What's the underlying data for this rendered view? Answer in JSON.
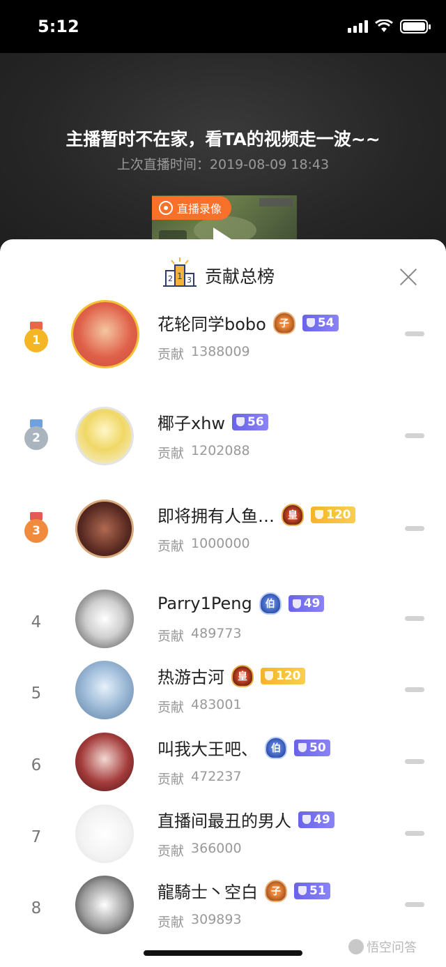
{
  "status_bar": {
    "time": "5:12"
  },
  "live": {
    "offline_title": "主播暂时不在家，看TA的视频走一波~~",
    "last_live_label": "上次直播时间：2019-08-09 18:43",
    "replay_tag": "直播录像"
  },
  "sheet": {
    "title": "贡献总榜"
  },
  "ranking": [
    {
      "rank": "1",
      "name": "花轮同学bobo",
      "contrib_label": "贡献",
      "contrib": "1388009",
      "crest": "子",
      "level": "54",
      "level_color": "purple"
    },
    {
      "rank": "2",
      "name": "椰子xhw",
      "contrib_label": "贡献",
      "contrib": "1202088",
      "crest": "",
      "level": "56",
      "level_color": "purple"
    },
    {
      "rank": "3",
      "name": "即将拥有人鱼…",
      "contrib_label": "贡献",
      "contrib": "1000000",
      "crest": "皇",
      "level": "120",
      "level_color": "gold"
    },
    {
      "rank": "4",
      "name": "Parry1Peng",
      "contrib_label": "贡献",
      "contrib": "489773",
      "crest": "伯",
      "level": "49",
      "level_color": "purple"
    },
    {
      "rank": "5",
      "name": "热游古河",
      "contrib_label": "贡献",
      "contrib": "483001",
      "crest": "皇",
      "level": "120",
      "level_color": "gold"
    },
    {
      "rank": "6",
      "name": "叫我大王吧、",
      "contrib_label": "贡献",
      "contrib": "472237",
      "crest": "伯",
      "level": "50",
      "level_color": "purple"
    },
    {
      "rank": "7",
      "name": "直播间最丑的男人",
      "contrib_label": "贡献",
      "contrib": "366000",
      "crest": "",
      "level": "49",
      "level_color": "purple"
    },
    {
      "rank": "8",
      "name": "龍騎士丶空白",
      "contrib_label": "贡献",
      "contrib": "309893",
      "crest": "子",
      "level": "51",
      "level_color": "purple"
    }
  ],
  "watermark": "悟空问答",
  "colors": {
    "accent": "#f7712b",
    "gold": "#f5c036",
    "silver": "#a9b4bf",
    "bronze": "#f08a3c"
  }
}
